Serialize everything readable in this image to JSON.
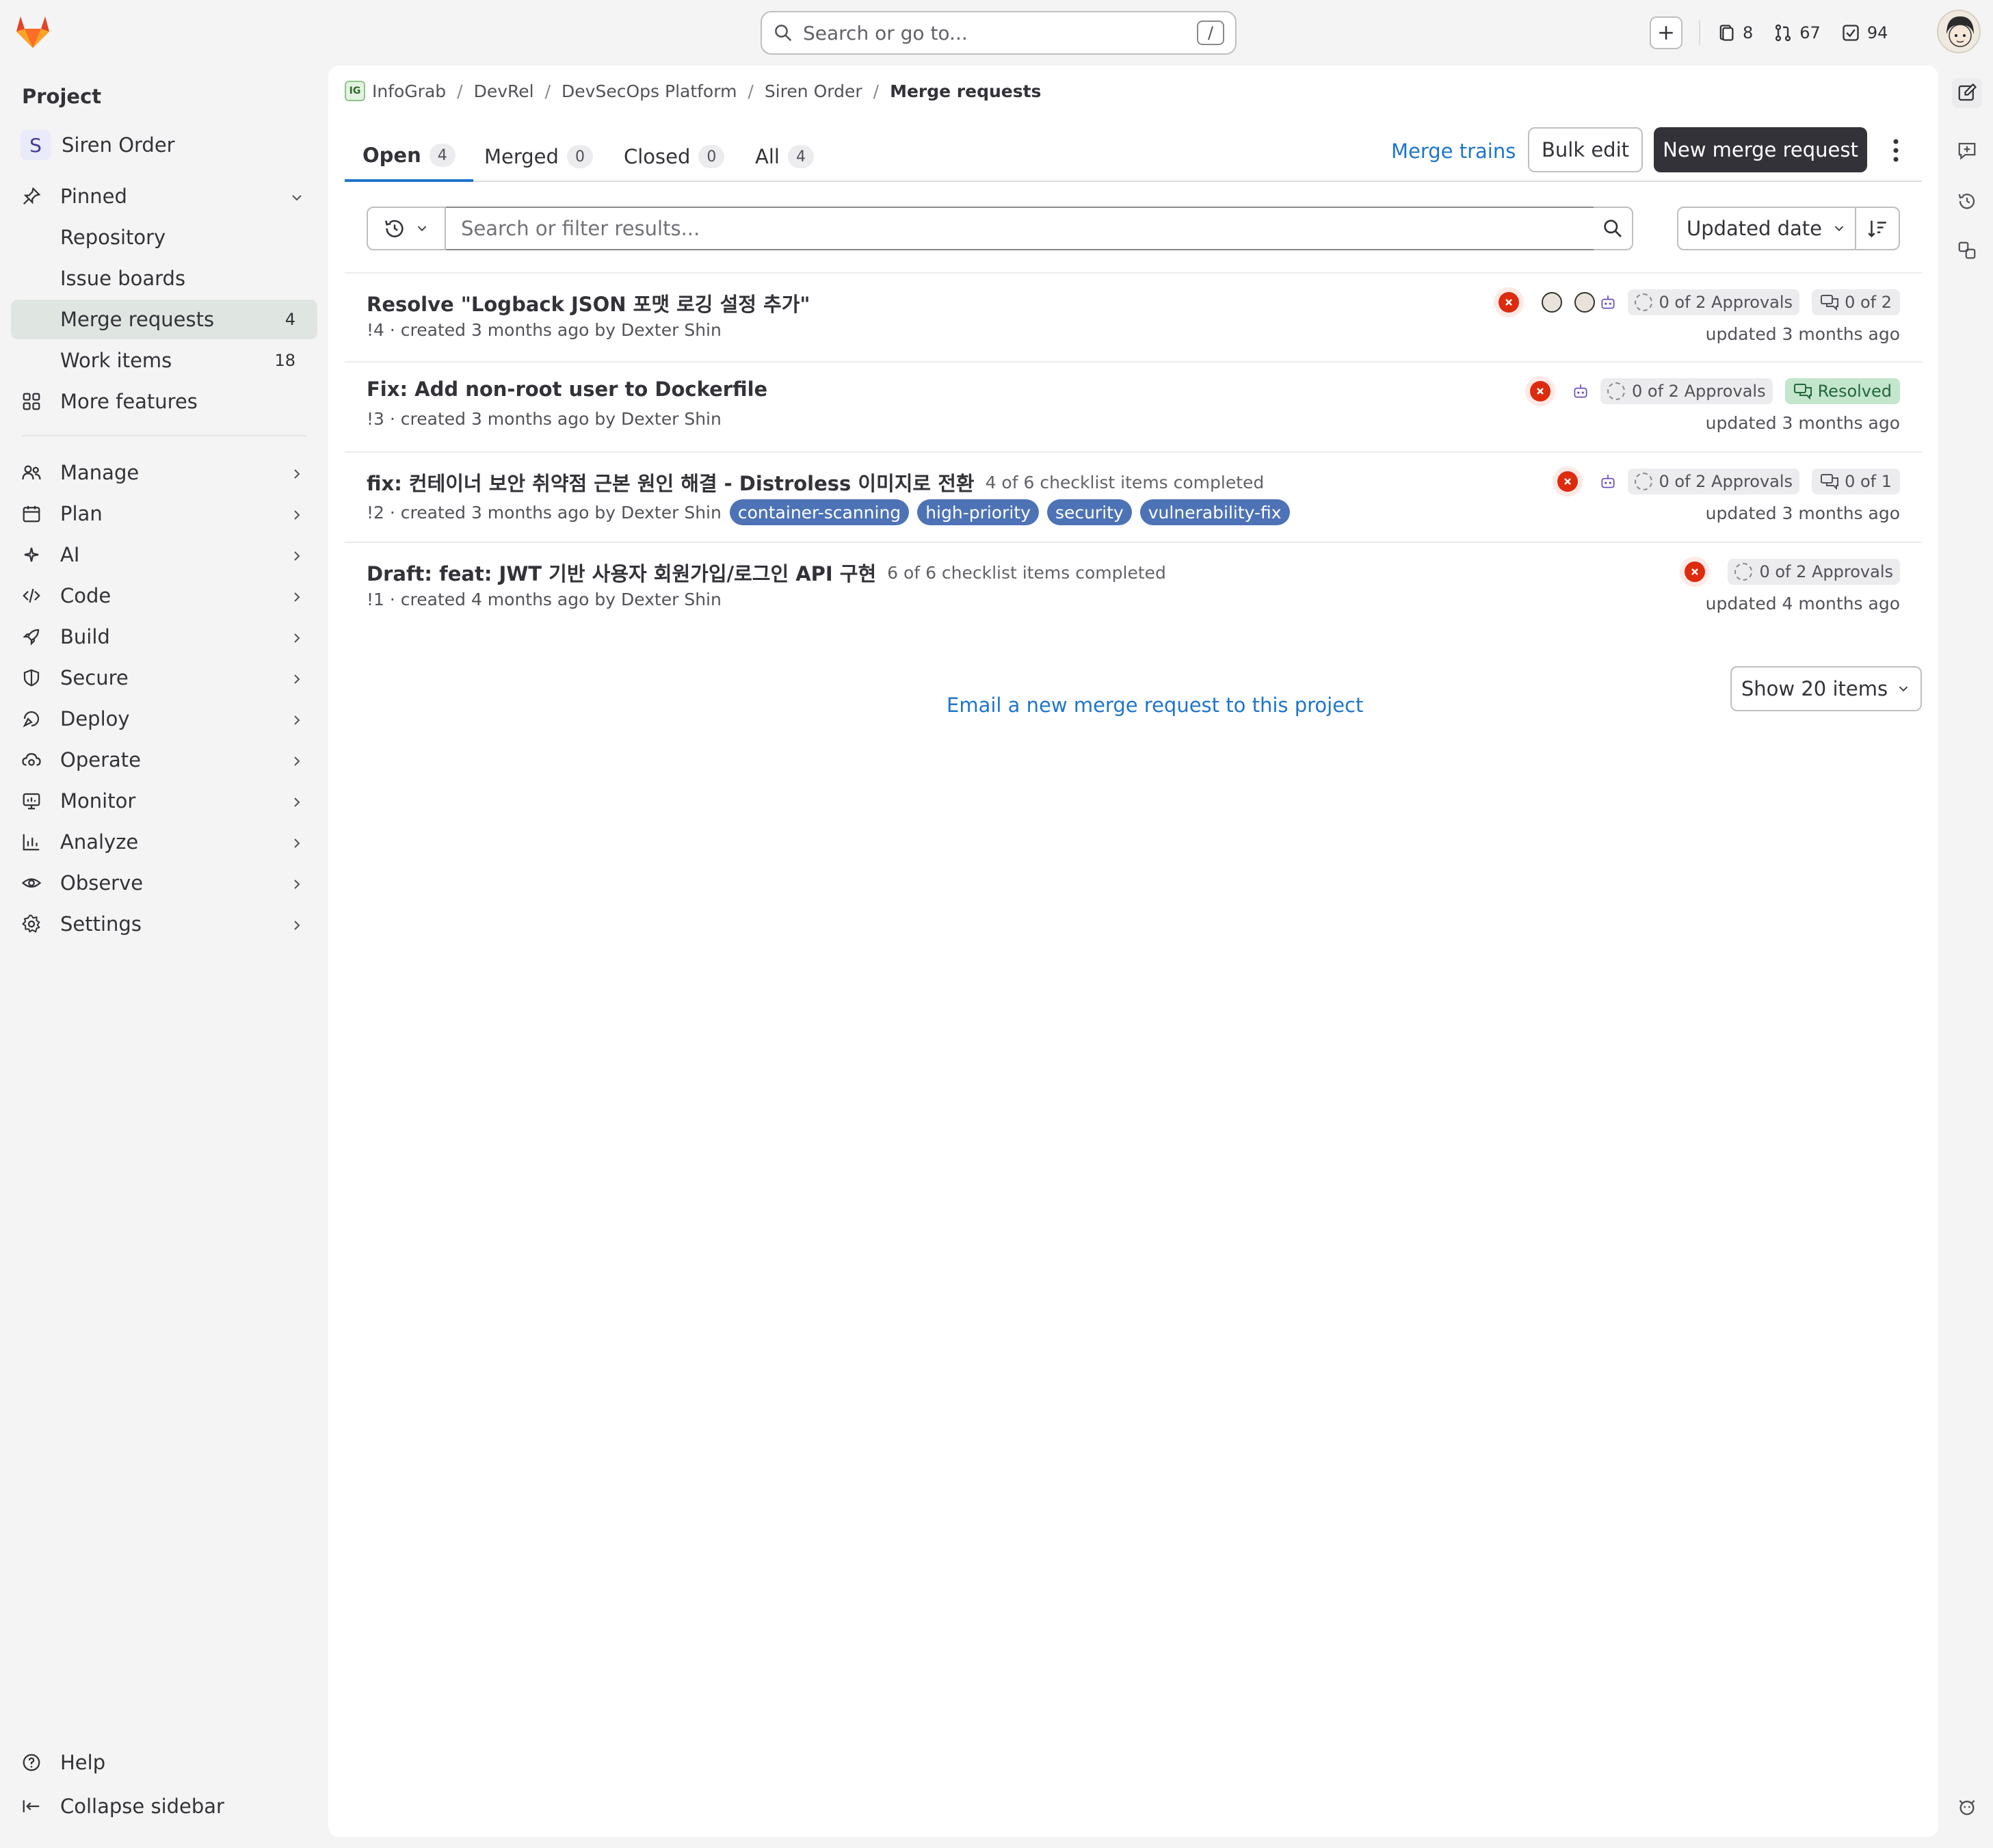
{
  "topbar": {
    "search_placeholder": "Search or go to...",
    "search_shortcut": "/",
    "issues_count": "8",
    "mr_count": "67",
    "todo_count": "94"
  },
  "sidebar": {
    "section_title": "Project",
    "project_initial": "S",
    "project_name": "Siren Order",
    "pinned_label": "Pinned",
    "pinned_items": [
      {
        "label": "Repository",
        "count": ""
      },
      {
        "label": "Issue boards",
        "count": ""
      },
      {
        "label": "Merge requests",
        "count": "4"
      },
      {
        "label": "Work items",
        "count": "18"
      }
    ],
    "more_features": "More features",
    "groups": [
      {
        "label": "Manage",
        "icon": "users-icon"
      },
      {
        "label": "Plan",
        "icon": "calendar-icon"
      },
      {
        "label": "AI",
        "icon": "sparkle-icon"
      },
      {
        "label": "Code",
        "icon": "code-icon"
      },
      {
        "label": "Build",
        "icon": "rocket-icon"
      },
      {
        "label": "Secure",
        "icon": "shield-icon"
      },
      {
        "label": "Deploy",
        "icon": "deploy-icon"
      },
      {
        "label": "Operate",
        "icon": "cloud-gear-icon"
      },
      {
        "label": "Monitor",
        "icon": "monitor-icon"
      },
      {
        "label": "Analyze",
        "icon": "chart-icon"
      },
      {
        "label": "Observe",
        "icon": "eye-icon"
      },
      {
        "label": "Settings",
        "icon": "gear-icon"
      }
    ],
    "help": "Help",
    "collapse": "Collapse sidebar"
  },
  "breadcrumbs": [
    "InfoGrab",
    "DevRel",
    "DevSecOps Platform",
    "Siren Order",
    "Merge requests"
  ],
  "breadcrumb_logo_text": "IG",
  "tabs": [
    {
      "label": "Open",
      "count": "4"
    },
    {
      "label": "Merged",
      "count": "0"
    },
    {
      "label": "Closed",
      "count": "0"
    },
    {
      "label": "All",
      "count": "4"
    }
  ],
  "actions": {
    "merge_trains": "Merge trains",
    "bulk_edit": "Bulk edit",
    "new_mr": "New merge request"
  },
  "filter": {
    "placeholder": "Search or filter results...",
    "sort_label": "Updated date"
  },
  "merge_requests": [
    {
      "title": "Resolve \"Logback JSON 포맷 로깅 설정 추가\"",
      "checklist": "",
      "meta": "!4 · created 3 months ago by Dexter Shin",
      "labels": [],
      "approvals": "0 of 2 Approvals",
      "comments": "0 of 2",
      "resolved": "",
      "updated": "updated 3 months ago"
    },
    {
      "title": "Fix: Add non-root user to Dockerfile",
      "checklist": "",
      "meta": "!3 · created 3 months ago by Dexter Shin",
      "labels": [],
      "approvals": "0 of 2 Approvals",
      "comments": "",
      "resolved": "Resolved",
      "updated": "updated 3 months ago"
    },
    {
      "title": "fix: 컨테이너 보안 취약점 근본 원인 해결 - Distroless 이미지로 전환",
      "checklist": "4 of 6 checklist items completed",
      "meta": "!2 · created 3 months ago by Dexter Shin",
      "labels": [
        "container-scanning",
        "high-priority",
        "security",
        "vulnerability-fix"
      ],
      "approvals": "0 of 2 Approvals",
      "comments": "0 of 1",
      "resolved": "",
      "updated": "updated 3 months ago"
    },
    {
      "title": "Draft: feat: JWT 기반 사용자 회원가입/로그인 API 구현",
      "checklist": "6 of 6 checklist items completed",
      "meta": "!1 · created 4 months ago by Dexter Shin",
      "labels": [],
      "approvals": "0 of 2 Approvals",
      "comments": "",
      "resolved": "",
      "updated": "updated 4 months ago"
    }
  ],
  "footer": {
    "email_link": "Email a new merge request to this project",
    "show_items": "Show 20 items"
  },
  "colors": {
    "accent": "#1f75cb",
    "primary_button": "#333238",
    "label_bg": "#4d73b6",
    "pipeline_failed": "#dd2b0e",
    "active_nav": "#dfe5e1"
  }
}
